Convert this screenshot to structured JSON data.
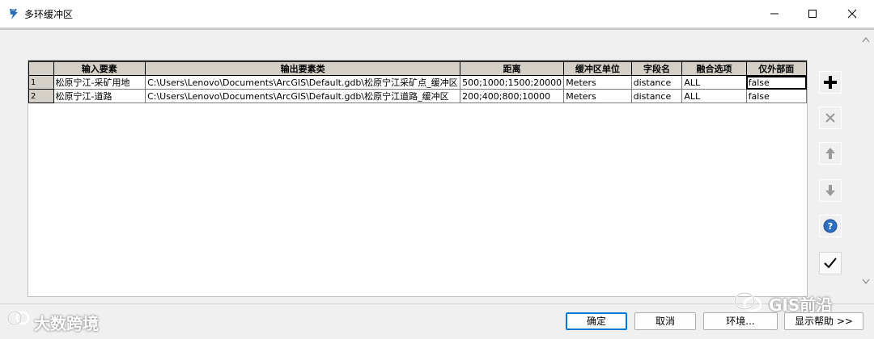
{
  "window": {
    "title": "多环缓冲区",
    "controls": {
      "minimize_icon": "minimize-icon",
      "maximize_icon": "maximize-icon",
      "close_icon": "close-icon"
    }
  },
  "table": {
    "columns": [
      "",
      "输入要素",
      "输出要素类",
      "距离",
      "缓冲区单位",
      "字段名",
      "融合选项",
      "仅外部面"
    ],
    "rows": [
      {
        "num": "1",
        "input": "松原宁江-采矿用地",
        "output": "C:\\Users\\Lenovo\\Documents\\ArcGIS\\Default.gdb\\松原宁江采矿点_缓冲区",
        "distance": "500;1000;1500;20000",
        "unit": "Meters",
        "field": "distance",
        "dissolve": "ALL",
        "outside_only": "false"
      },
      {
        "num": "2",
        "input": "松原宁江-道路",
        "output": "C:\\Users\\Lenovo\\Documents\\ArcGIS\\Default.gdb\\松原宁江道路_缓冲区",
        "distance": "200;400;800;10000",
        "unit": "Meters",
        "field": "distance",
        "dissolve": "ALL",
        "outside_only": "false"
      }
    ]
  },
  "side_buttons": [
    "add-icon",
    "delete-icon",
    "move-up-icon",
    "move-down-icon",
    "help-icon",
    "check-icon"
  ],
  "footer": {
    "ok_label": "确定",
    "cancel_label": "取消",
    "env_label": "环境...",
    "help_label": "显示帮助 >>"
  },
  "watermarks": {
    "left": "大数跨境",
    "right": "GIS前沿"
  },
  "colors": {
    "accent": "#0078d7",
    "help_blue": "#2d6fbf",
    "header_bg": "#d4d0c8"
  }
}
